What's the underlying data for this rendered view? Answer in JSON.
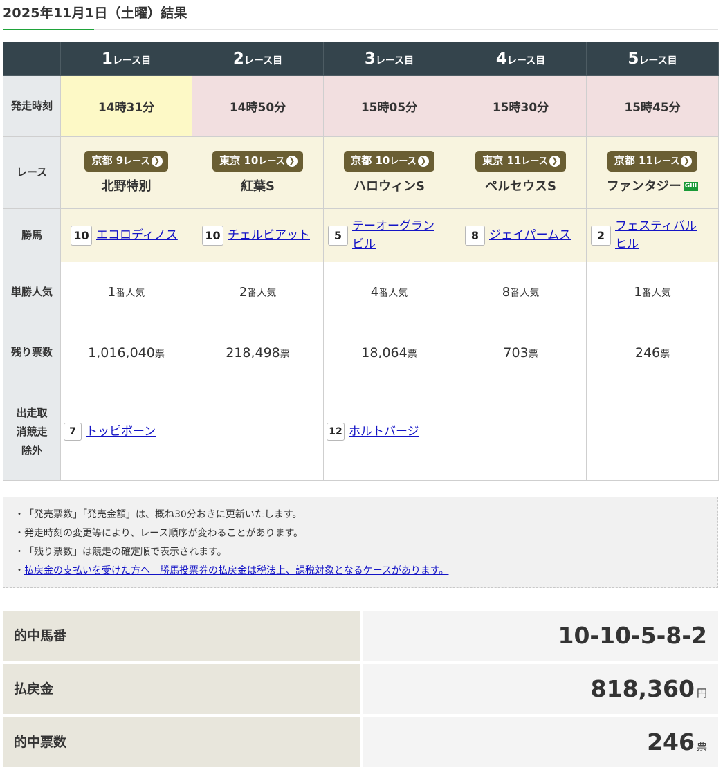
{
  "heading": {
    "title": "2025年11月1日（土曜）結果"
  },
  "colors": {
    "accent": "#1fa33a",
    "header_bg": "#34444c",
    "venue_badge": "#6a5e33",
    "grade_badge": "#1a9a37",
    "link": "#1414c6"
  },
  "row_labels": {
    "time": "発走時刻",
    "race": "レース",
    "winner": "勝馬",
    "popularity": "単勝人気",
    "remaining": "残り票数",
    "scratch": "出走取消競走除外"
  },
  "races": [
    {
      "num": "1",
      "suffix": "レース目",
      "time": "14時31分",
      "venue": "京都",
      "race_no": "9",
      "race_unit": "レース",
      "race_name": "北野特別",
      "grade": "",
      "winner_no": "10",
      "winner_name": "エコロディノス",
      "pop_num": "1",
      "pop_unit": "番人気",
      "left_votes": "1,016,040",
      "left_unit": "票",
      "scratch_no": "7",
      "scratch_name": "トッピボーン"
    },
    {
      "num": "2",
      "suffix": "レース目",
      "time": "14時50分",
      "venue": "東京",
      "race_no": "10",
      "race_unit": "レース",
      "race_name": "紅葉S",
      "grade": "",
      "winner_no": "10",
      "winner_name": "チェルビアット",
      "pop_num": "2",
      "pop_unit": "番人気",
      "left_votes": "218,498",
      "left_unit": "票",
      "scratch_no": "",
      "scratch_name": ""
    },
    {
      "num": "3",
      "suffix": "レース目",
      "time": "15時05分",
      "venue": "京都",
      "race_no": "10",
      "race_unit": "レース",
      "race_name": "ハロウィンS",
      "grade": "",
      "winner_no": "5",
      "winner_name": "テーオーグランビル",
      "pop_num": "4",
      "pop_unit": "番人気",
      "left_votes": "18,064",
      "left_unit": "票",
      "scratch_no": "12",
      "scratch_name": "ホルトバージ"
    },
    {
      "num": "4",
      "suffix": "レース目",
      "time": "15時30分",
      "venue": "東京",
      "race_no": "11",
      "race_unit": "レース",
      "race_name": "ペルセウスS",
      "grade": "",
      "winner_no": "8",
      "winner_name": "ジェイパームス",
      "pop_num": "8",
      "pop_unit": "番人気",
      "left_votes": "703",
      "left_unit": "票",
      "scratch_no": "",
      "scratch_name": ""
    },
    {
      "num": "5",
      "suffix": "レース目",
      "time": "15時45分",
      "venue": "京都",
      "race_no": "11",
      "race_unit": "レース",
      "race_name": "ファンタジー",
      "grade": "GIII",
      "winner_no": "2",
      "winner_name": "フェスティバルヒル",
      "pop_num": "1",
      "pop_unit": "番人気",
      "left_votes": "246",
      "left_unit": "票",
      "scratch_no": "",
      "scratch_name": ""
    }
  ],
  "notes": [
    "「発売票数」「発売金額」は、概ね30分おきに更新いたします。",
    "発走時刻の変更等により、レース順序が変わることがあります。",
    "「残り票数」は競走の確定順で表示されます。"
  ],
  "notes_link": "払戻金の支払いを受けた方へ　勝馬投票券の払戻金は税法上、課税対象となるケースがあります。",
  "summary": {
    "numbers_label": "的中馬番",
    "numbers_value": "10-10-5-8-2",
    "payout_label": "払戻金",
    "payout_value": "818,360",
    "payout_unit": "円",
    "tickets_label": "的中票数",
    "tickets_value": "246",
    "tickets_unit": "票"
  }
}
